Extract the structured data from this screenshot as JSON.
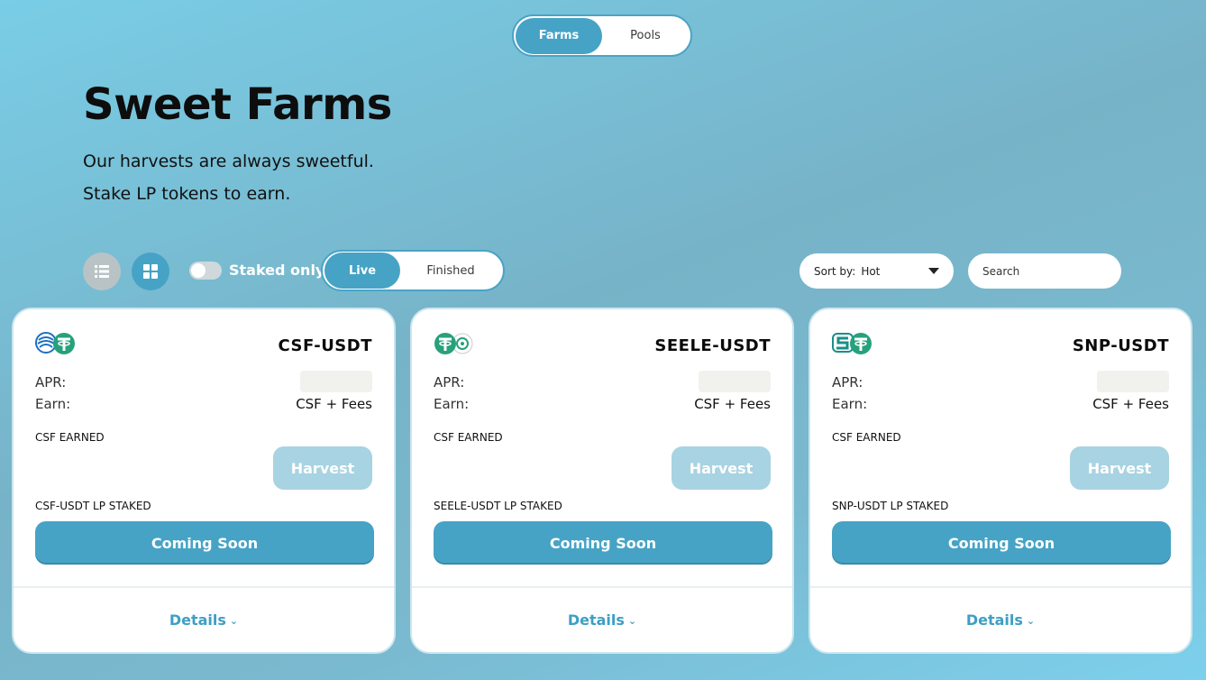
{
  "top_tabs": [
    {
      "label": "Farms",
      "active": true
    },
    {
      "label": "Pools",
      "active": false
    }
  ],
  "header": {
    "title": "Sweet Farms",
    "subtitle_1": "Our harvests are always sweetful.",
    "subtitle_2": "Stake LP tokens to earn."
  },
  "controls": {
    "view_list_icon": "list-icon",
    "view_grid_icon": "grid-icon",
    "staked_only_label": "Staked only",
    "staked_only_on": false,
    "status_tabs": [
      {
        "label": "Live",
        "active": true
      },
      {
        "label": "Finished",
        "active": false
      }
    ],
    "sort_label": "Sort by:",
    "sort_value": "Hot",
    "search_placeholder": "Search"
  },
  "cards": [
    {
      "pair": "CSF-USDT",
      "apr_label": "APR:",
      "earn_label": "Earn:",
      "earn_value": "CSF + Fees",
      "earned_label": "CSF EARNED",
      "harvest_label": "Harvest",
      "staked_label": "CSF-USDT LP STAKED",
      "action_label": "Coming Soon",
      "details_label": "Details"
    },
    {
      "pair": "SEELE-USDT",
      "apr_label": "APR:",
      "earn_label": "Earn:",
      "earn_value": "CSF + Fees",
      "earned_label": "CSF EARNED",
      "harvest_label": "Harvest",
      "staked_label": "SEELE-USDT LP STAKED",
      "action_label": "Coming Soon",
      "details_label": "Details"
    },
    {
      "pair": "SNP-USDT",
      "apr_label": "APR:",
      "earn_label": "Earn:",
      "earn_value": "CSF + Fees",
      "earned_label": "CSF EARNED",
      "harvest_label": "Harvest",
      "staked_label": "SNP-USDT LP STAKED",
      "action_label": "Coming Soon",
      "details_label": "Details"
    }
  ],
  "colors": {
    "accent": "#46a3c6",
    "harvest_disabled": "#a8d3e2",
    "usdt_green": "#26a17b"
  }
}
